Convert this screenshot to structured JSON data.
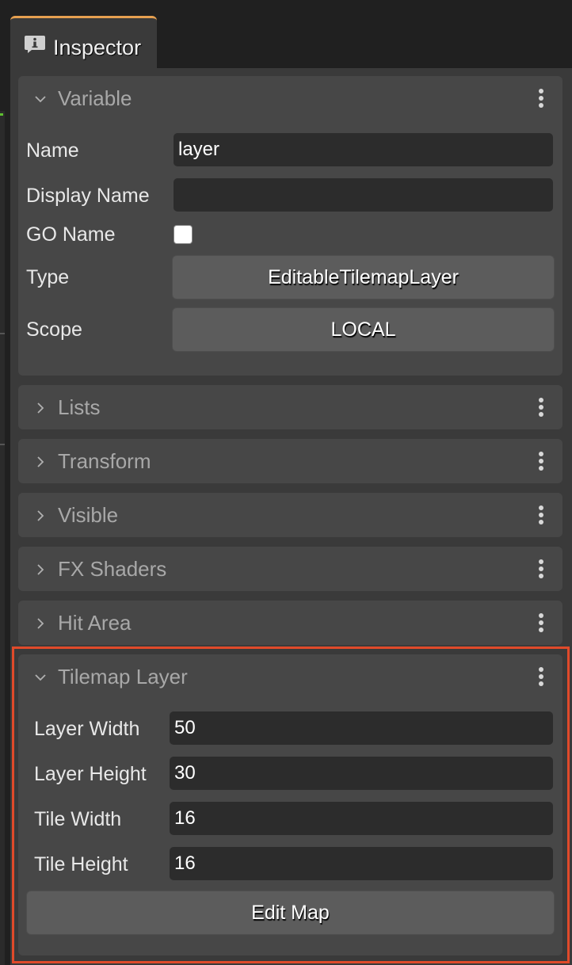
{
  "tab": {
    "title": "Inspector",
    "icon": "info-bubble-icon"
  },
  "colors": {
    "tab_accent": "#e6a050",
    "highlight_border": "#e04a2a"
  },
  "variable": {
    "title": "Variable",
    "expanded": true,
    "name_label": "Name",
    "name_value": "layer",
    "display_name_label": "Display Name",
    "display_name_value": "",
    "go_name_label": "GO Name",
    "go_name_checked": false,
    "type_label": "Type",
    "type_value": "EditableTilemapLayer",
    "scope_label": "Scope",
    "scope_value": "LOCAL"
  },
  "collapsed_sections": [
    {
      "title": "Lists"
    },
    {
      "title": "Transform"
    },
    {
      "title": "Visible"
    },
    {
      "title": "FX Shaders"
    },
    {
      "title": "Hit Area"
    }
  ],
  "tilemap": {
    "title": "Tilemap Layer",
    "expanded": true,
    "fields": [
      {
        "label": "Layer Width",
        "value": "50"
      },
      {
        "label": "Layer Height",
        "value": "30"
      },
      {
        "label": "Tile Width",
        "value": "16"
      },
      {
        "label": "Tile Height",
        "value": "16"
      }
    ],
    "edit_button": "Edit Map"
  }
}
